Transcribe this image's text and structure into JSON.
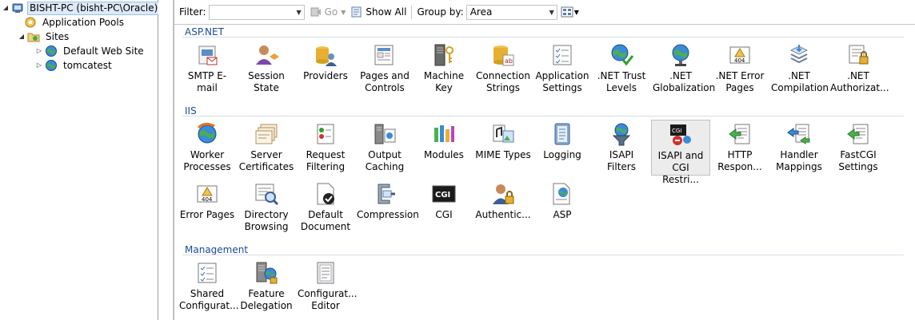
{
  "tree": {
    "root": "BISHT-PC (bisht-PC\\Oracle)",
    "app_pools": "Application Pools",
    "sites": "Sites",
    "site1": "Default Web Site",
    "site2": "tomcatest"
  },
  "toolbar": {
    "filter_label": "Filter:",
    "filter_value": "",
    "go_label": "Go",
    "show_all_label": "Show All",
    "group_by_label": "Group by:",
    "group_by_value": "Area"
  },
  "groups": {
    "aspnet": "ASP.NET",
    "iis": "IIS",
    "management": "Management"
  },
  "aspnet_items": [
    "SMTP E-mail",
    "Session State",
    "Providers",
    "Pages and Controls",
    "Machine Key",
    "Connection Strings",
    "Application Settings",
    ".NET Trust Levels",
    ".NET Globalization",
    ".NET Error Pages",
    ".NET Compilation",
    ".NET Authorizat..."
  ],
  "iis_items": [
    "Worker Processes",
    "Server Certificates",
    "Request Filtering",
    "Output Caching",
    "Modules",
    "MIME Types",
    "Logging",
    "ISAPI Filters",
    "ISAPI and CGI Restri...",
    "HTTP Respon...",
    "Handler Mappings",
    "FastCGI Settings",
    "Error Pages",
    "Directory Browsing",
    "Default Document",
    "Compression",
    "CGI",
    "Authentic...",
    "ASP"
  ],
  "management_items": [
    "Shared Configurat...",
    "Feature Delegation",
    "Configurat... Editor"
  ],
  "icon_texts": {
    "cgi": "CGI",
    "error_code": "404"
  }
}
